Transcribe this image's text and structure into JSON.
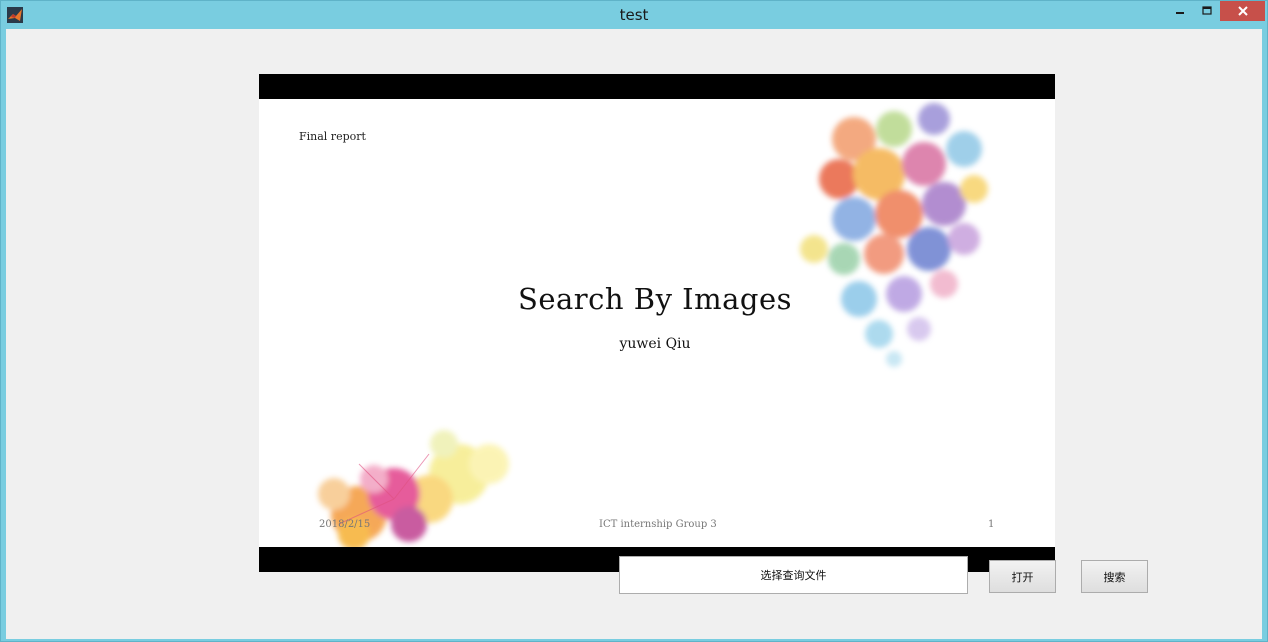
{
  "window": {
    "title": "test",
    "controls": {
      "minimize": "minimize",
      "maximize": "maximize",
      "close": "close"
    },
    "colors": {
      "frame": "#79cde0",
      "close": "#c7504a",
      "client": "#f0f0f0"
    }
  },
  "slide": {
    "label": "Final report",
    "title": "Search By Images",
    "author": "yuwei Qiu",
    "footer": {
      "date": "2018/2/15",
      "center": "ICT internship  Group 3",
      "page": "1"
    }
  },
  "controls": {
    "file_field_label": "选择查询文件",
    "open_button": "打开",
    "search_button": "搜索"
  }
}
